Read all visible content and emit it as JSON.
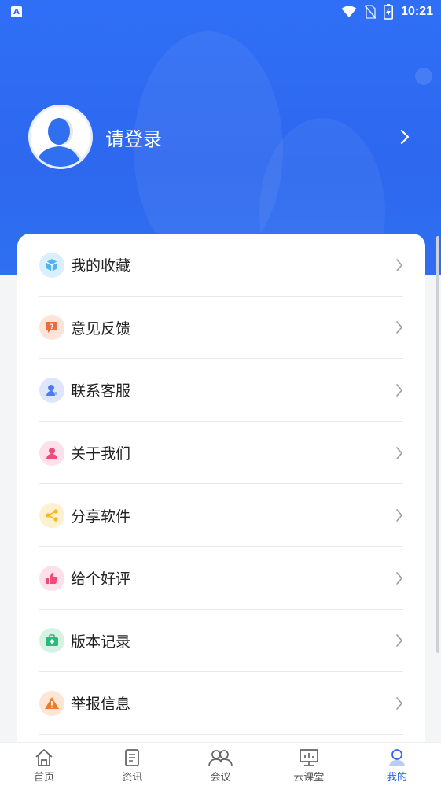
{
  "status_bar": {
    "app_badge": "A",
    "time": "10:21"
  },
  "profile": {
    "login_text": "请登录"
  },
  "menu": {
    "items": [
      {
        "label": "我的收藏",
        "icon": "favorite-icon",
        "color": "#4fb3f2"
      },
      {
        "label": "意见反馈",
        "icon": "feedback-icon",
        "color": "#f06a3a"
      },
      {
        "label": "联系客服",
        "icon": "customer-service-icon",
        "color": "#4b7bf0"
      },
      {
        "label": "关于我们",
        "icon": "about-icon",
        "color": "#f04a7a"
      },
      {
        "label": "分享软件",
        "icon": "share-icon",
        "color": "#f5b81f"
      },
      {
        "label": "给个好评",
        "icon": "thumbs-up-icon",
        "color": "#f04a7a"
      },
      {
        "label": "版本记录",
        "icon": "version-icon",
        "color": "#2fb87a"
      },
      {
        "label": "举报信息",
        "icon": "warning-icon",
        "color": "#f07a2a"
      }
    ]
  },
  "tabbar": {
    "tabs": [
      {
        "label": "首页",
        "icon": "home-icon"
      },
      {
        "label": "资讯",
        "icon": "news-icon"
      },
      {
        "label": "会议",
        "icon": "meeting-icon"
      },
      {
        "label": "云课堂",
        "icon": "cloud-class-icon"
      },
      {
        "label": "我的",
        "icon": "profile-icon",
        "active": true
      }
    ],
    "active_color": "#2d68ef"
  },
  "colors": {
    "header": "#2d68ef",
    "background": "#f4f5f7"
  }
}
